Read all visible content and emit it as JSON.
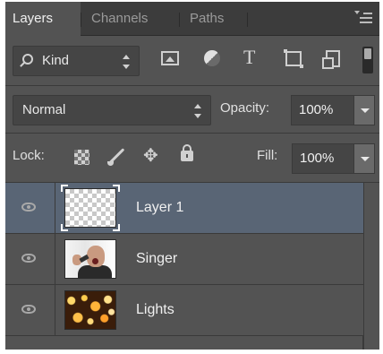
{
  "tabs": [
    {
      "label": "Layers"
    },
    {
      "label": "Channels"
    },
    {
      "label": "Paths"
    }
  ],
  "filter": {
    "kind_label": "Kind",
    "type_glyph": "T"
  },
  "blend": {
    "mode": "Normal",
    "opacity_label": "Opacity:",
    "opacity_value": "100%"
  },
  "lock": {
    "label": "Lock:",
    "move_glyph": "✥",
    "fill_label": "Fill:",
    "fill_value": "100%"
  },
  "layers": [
    {
      "name": "Layer 1",
      "selected": true,
      "visible": true
    },
    {
      "name": "Singer",
      "selected": false,
      "visible": true
    },
    {
      "name": "Lights",
      "selected": false,
      "visible": true
    }
  ],
  "colors": {
    "panel": "#535353",
    "selected_row": "#596575",
    "tab_bar": "#3c3c3c"
  }
}
